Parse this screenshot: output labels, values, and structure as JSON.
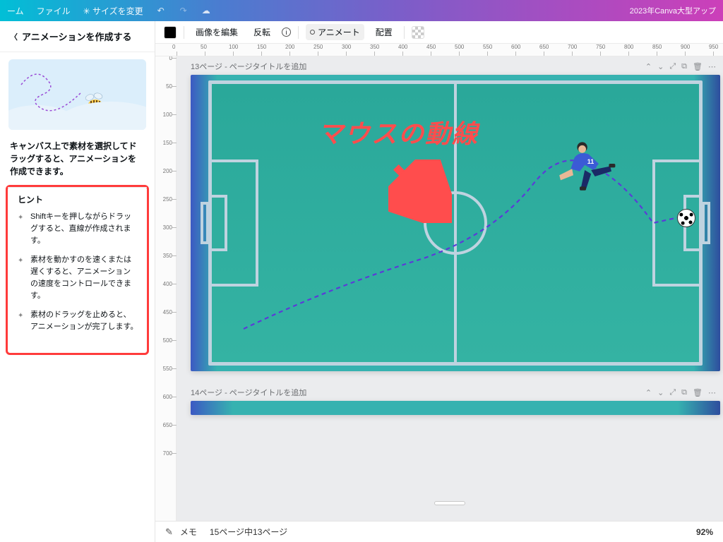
{
  "topbar": {
    "home": "ーム",
    "file": "ファイル",
    "resize": "サイズを変更",
    "banner": "2023年Canva大型アップ"
  },
  "sidebar": {
    "back_label": "アニメーションを作成する",
    "caption": "キャンバス上で素材を選択してドラッグすると、アニメーションを作成できます。",
    "hints_title": "ヒント",
    "hints": [
      "Shiftキーを押しながらドラッグすると、直線が作成されます。",
      "素材を動かすのを速くまたは遅くすると、アニメーションの速度をコントロールできます。",
      "素材のドラッグを止めると、アニメーションが完了します。"
    ]
  },
  "toolbar": {
    "edit_image": "画像を編集",
    "flip": "反転",
    "animate": "アニメート",
    "position": "配置"
  },
  "ruler": {
    "top": [
      "0",
      "50",
      "100",
      "150",
      "200",
      "250",
      "300",
      "350",
      "400",
      "450",
      "500",
      "550",
      "600",
      "650",
      "700",
      "750",
      "800",
      "850",
      "900",
      "950"
    ],
    "left": [
      "0",
      "50",
      "100",
      "150",
      "200",
      "250",
      "300",
      "350",
      "400",
      "450",
      "500",
      "550",
      "600",
      "650",
      "700"
    ]
  },
  "pages": {
    "p1_label": "13ページ - ページタイトルを追加",
    "p2_label": "14ページ - ページタイトルを追加"
  },
  "canvas": {
    "annotation": "マウスの動線",
    "player_number": "11"
  },
  "bottombar": {
    "notes": "メモ",
    "page_count": "15ページ中13ページ",
    "zoom": "92%"
  },
  "colors": {
    "accent_red": "#ff4d4d",
    "path_purple": "#5b3bd8"
  }
}
